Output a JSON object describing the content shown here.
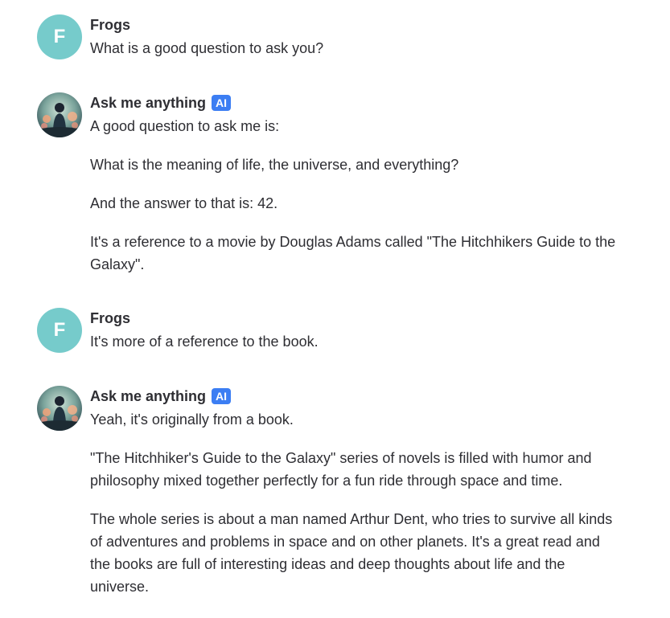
{
  "messages": [
    {
      "author": "Frogs",
      "avatar_letter": "F",
      "paragraphs": [
        "What is a good question to ask you?"
      ]
    },
    {
      "author": "Ask me anything",
      "badge": "AI",
      "paragraphs": [
        "A good question to ask me is:",
        "What is the meaning of life, the universe, and everything?",
        "And the answer to that is: 42.",
        "It's a reference to a movie by Douglas Adams called \"The Hitchhikers Guide to the Galaxy\"."
      ]
    },
    {
      "author": "Frogs",
      "avatar_letter": "F",
      "paragraphs": [
        "It's more of a reference to the book."
      ]
    },
    {
      "author": "Ask me anything",
      "badge": "AI",
      "paragraphs": [
        "Yeah, it's originally from a book.",
        "\"The Hitchhiker's Guide to the Galaxy\" series of novels is filled with humor and philosophy mixed together perfectly for a fun ride through space and time.",
        "The whole series is about a man named Arthur Dent, who tries to survive all kinds of adventures and problems in space and on other planets.  It's a great read and the books are full of interesting ideas and deep thoughts about life and the universe."
      ]
    }
  ],
  "colors": {
    "user_avatar_bg": "#76cbcb",
    "ai_badge_bg": "#3c7ef3",
    "text": "#2e2e33"
  },
  "icons": {
    "ai_avatar": "ai-bot-avatar-icon"
  }
}
